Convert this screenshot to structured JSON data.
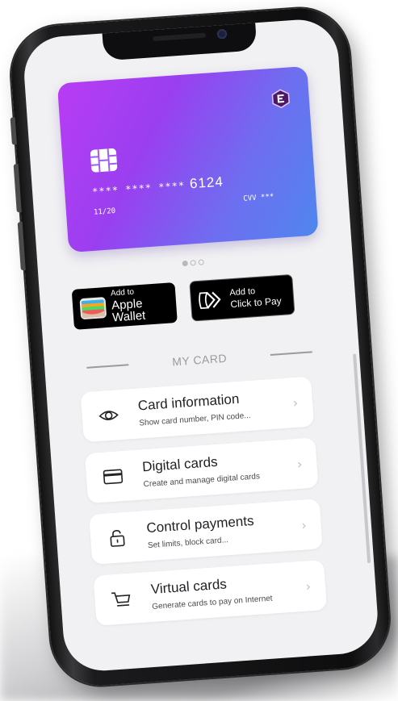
{
  "card": {
    "masked_number": "**** **** ****",
    "last4": "6124",
    "expiry": "11/20",
    "cvv": "CVV ***",
    "gradient": [
      "#b93cf4",
      "#4f86ee"
    ]
  },
  "carousel": {
    "pages": 3,
    "active": 1
  },
  "wallet_buttons": {
    "apple_small": "Add to",
    "apple_big": "Apple Wallet",
    "ctp_small": "Add to",
    "ctp_big": "Click to Pay"
  },
  "section": {
    "title": "MY CARD"
  },
  "menu": [
    {
      "title": "Card information",
      "subtitle": "Show card number, PIN code...",
      "icon": "eye-icon"
    },
    {
      "title": "Digital cards",
      "subtitle": "Create and manage digital cards",
      "icon": "card-icon"
    },
    {
      "title": "Control payments",
      "subtitle": "Set limits, block card...",
      "icon": "lock-icon"
    },
    {
      "title": "Virtual cards",
      "subtitle": "Generate cards to pay on Internet",
      "icon": "cart-icon"
    }
  ],
  "chevron": "›"
}
